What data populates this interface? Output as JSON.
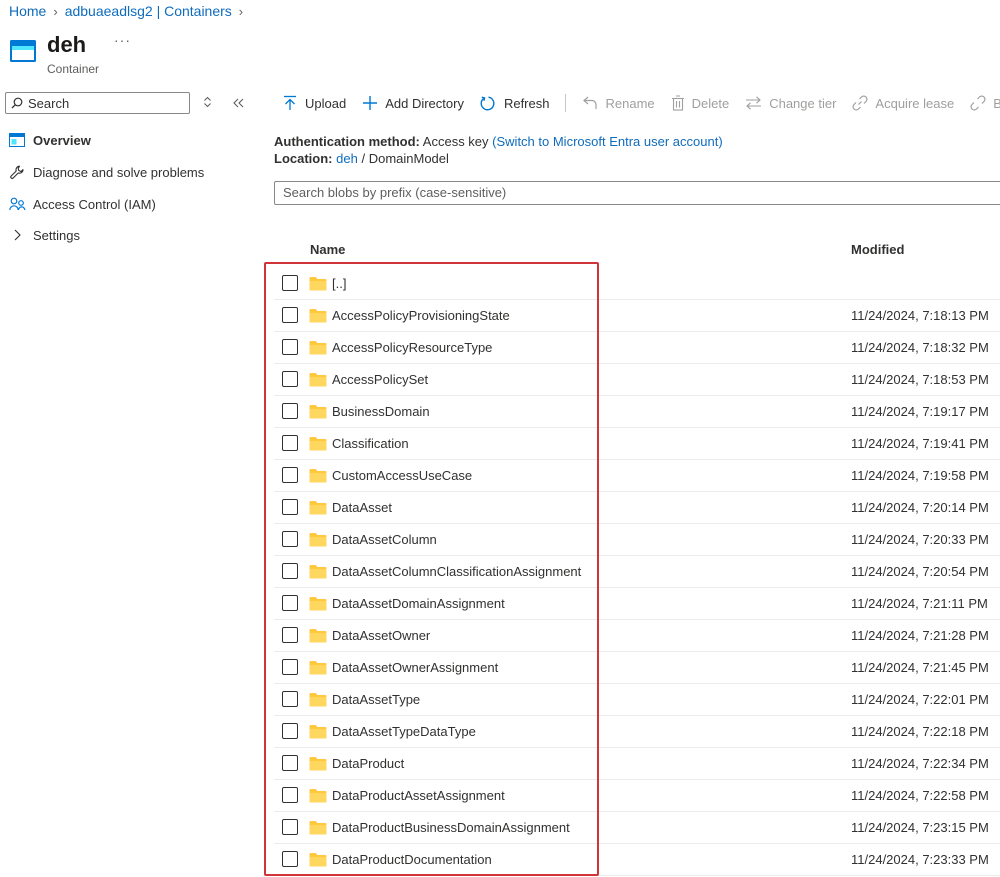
{
  "breadcrumb": {
    "home": "Home",
    "account": "adbuaeadlsg2 | Containers"
  },
  "header": {
    "title": "deh",
    "subtitle": "Container",
    "more": "···"
  },
  "sidebar": {
    "search_placeholder": "Search",
    "items": [
      {
        "label": "Overview",
        "icon": "overview-icon"
      },
      {
        "label": "Diagnose and solve problems",
        "icon": "wrench-icon"
      },
      {
        "label": "Access Control (IAM)",
        "icon": "people-icon"
      },
      {
        "label": "Settings",
        "icon": "chevron-right-icon"
      }
    ]
  },
  "toolbar": {
    "upload": "Upload",
    "add_directory": "Add Directory",
    "refresh": "Refresh",
    "rename": "Rename",
    "delete": "Delete",
    "change_tier": "Change tier",
    "acquire_lease": "Acquire lease",
    "break_lease": "B"
  },
  "info": {
    "auth_label": "Authentication method:",
    "auth_value": "Access key",
    "auth_link": "(Switch to Microsoft Entra user account)",
    "location_label": "Location:",
    "location_link": "deh",
    "location_sep": "/",
    "location_path": "DomainModel"
  },
  "blob_search": {
    "placeholder": "Search blobs by prefix (case-sensitive)"
  },
  "table": {
    "columns": {
      "name": "Name",
      "modified": "Modified"
    },
    "rows": [
      {
        "name": "[..]",
        "modified": ""
      },
      {
        "name": "AccessPolicyProvisioningState",
        "modified": "11/24/2024, 7:18:13 PM"
      },
      {
        "name": "AccessPolicyResourceType",
        "modified": "11/24/2024, 7:18:32 PM"
      },
      {
        "name": "AccessPolicySet",
        "modified": "11/24/2024, 7:18:53 PM"
      },
      {
        "name": "BusinessDomain",
        "modified": "11/24/2024, 7:19:17 PM"
      },
      {
        "name": "Classification",
        "modified": "11/24/2024, 7:19:41 PM"
      },
      {
        "name": "CustomAccessUseCase",
        "modified": "11/24/2024, 7:19:58 PM"
      },
      {
        "name": "DataAsset",
        "modified": "11/24/2024, 7:20:14 PM"
      },
      {
        "name": "DataAssetColumn",
        "modified": "11/24/2024, 7:20:33 PM"
      },
      {
        "name": "DataAssetColumnClassificationAssignment",
        "modified": "11/24/2024, 7:20:54 PM"
      },
      {
        "name": "DataAssetDomainAssignment",
        "modified": "11/24/2024, 7:21:11 PM"
      },
      {
        "name": "DataAssetOwner",
        "modified": "11/24/2024, 7:21:28 PM"
      },
      {
        "name": "DataAssetOwnerAssignment",
        "modified": "11/24/2024, 7:21:45 PM"
      },
      {
        "name": "DataAssetType",
        "modified": "11/24/2024, 7:22:01 PM"
      },
      {
        "name": "DataAssetTypeDataType",
        "modified": "11/24/2024, 7:22:18 PM"
      },
      {
        "name": "DataProduct",
        "modified": "11/24/2024, 7:22:34 PM"
      },
      {
        "name": "DataProductAssetAssignment",
        "modified": "11/24/2024, 7:22:58 PM"
      },
      {
        "name": "DataProductBusinessDomainAssignment",
        "modified": "11/24/2024, 7:23:15 PM"
      },
      {
        "name": "DataProductDocumentation",
        "modified": "11/24/2024, 7:23:33 PM"
      }
    ]
  },
  "colors": {
    "link": "#0f6cbd",
    "folder": "#ffc83d",
    "highlight": "#d13438",
    "disabled": "#a19f9d"
  }
}
